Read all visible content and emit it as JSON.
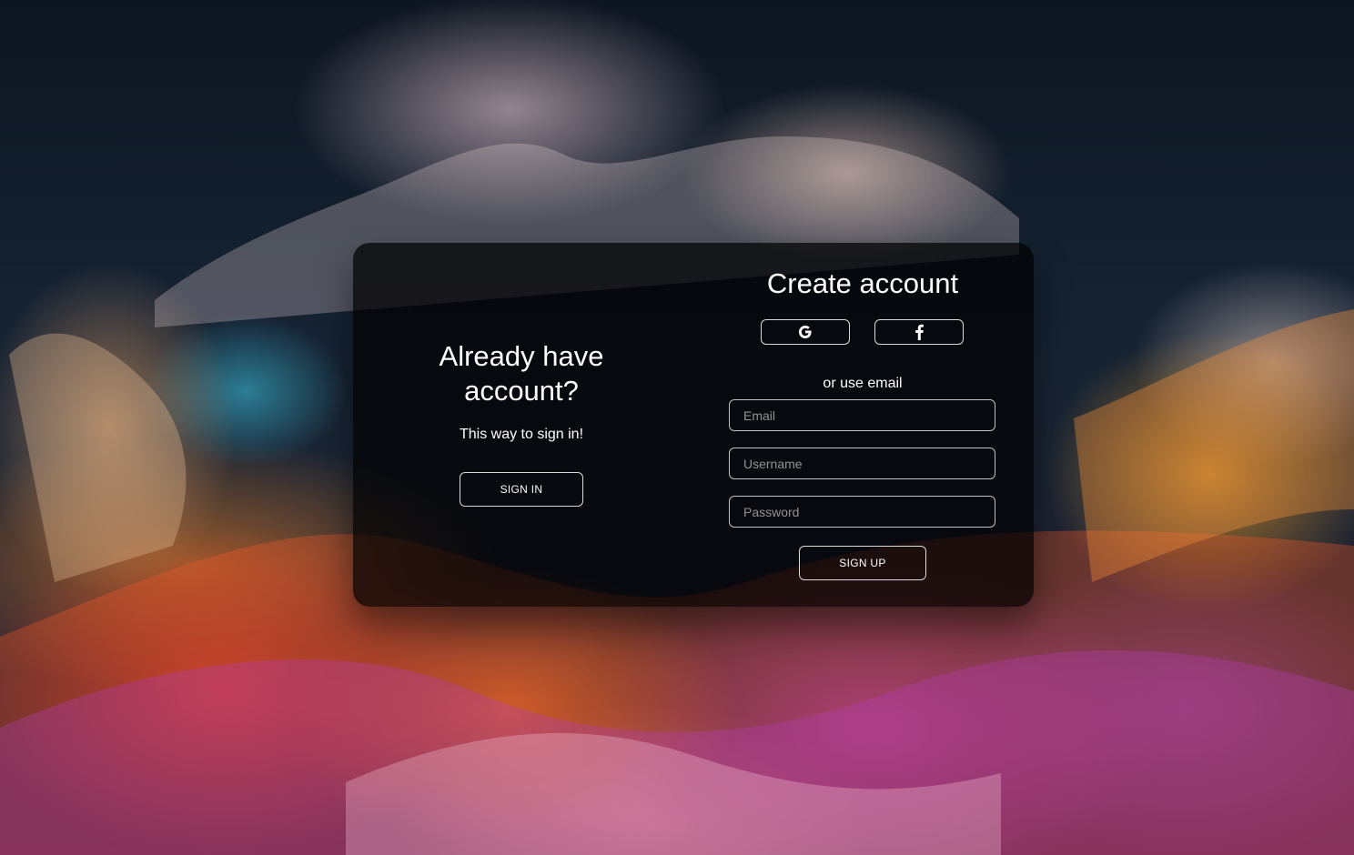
{
  "left_panel": {
    "title": "Already have account?",
    "subtitle": "This way to sign in!",
    "signin_label": "SIGN IN"
  },
  "right_panel": {
    "title": "Create account",
    "social": [
      {
        "icon": "google-icon",
        "glyph": "G"
      },
      {
        "icon": "facebook-icon",
        "glyph": "f"
      }
    ],
    "divider_text": "or use email",
    "fields": {
      "email_placeholder": "Email",
      "username_placeholder": "Username",
      "password_placeholder": "Password"
    },
    "signup_label": "SIGN UP"
  },
  "colors": {
    "card_background": "#000000",
    "text": "#ffffff",
    "border": "#ffffff"
  }
}
